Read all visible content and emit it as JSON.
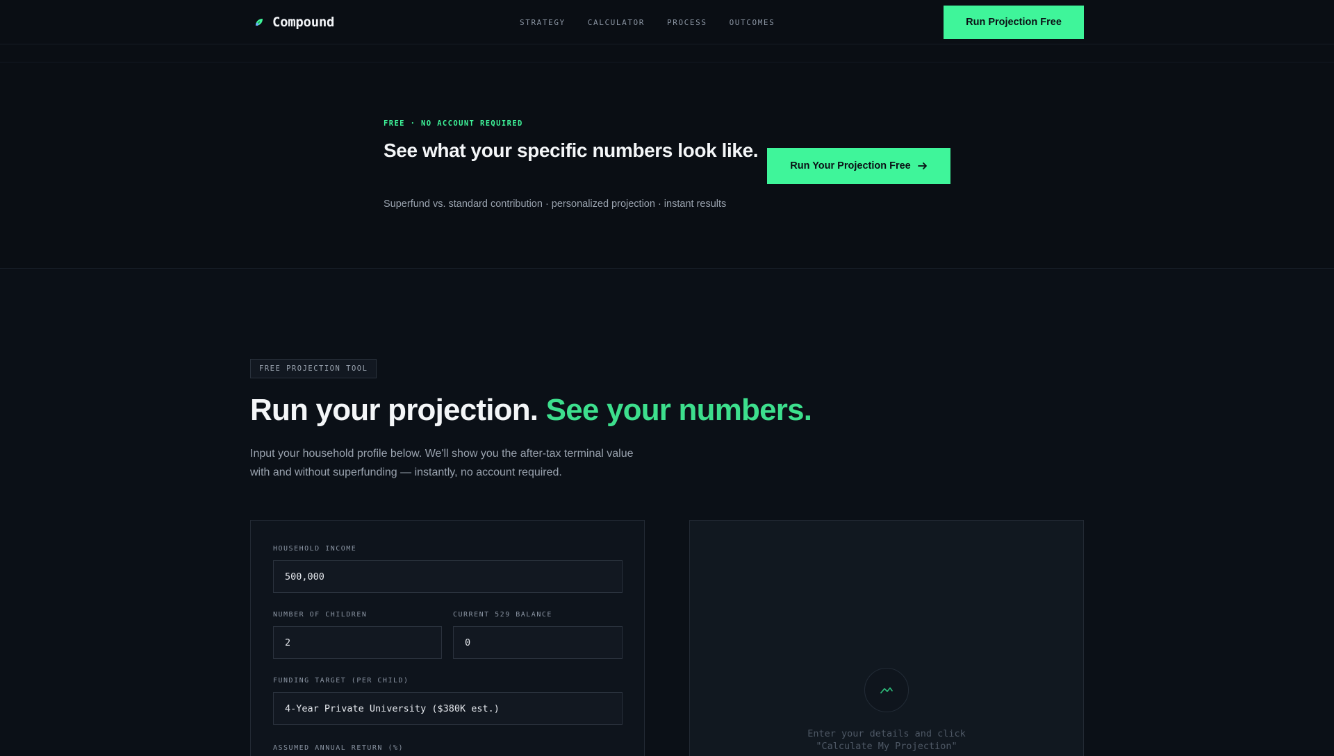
{
  "nav": {
    "brand": "Compound",
    "links": [
      "STRATEGY",
      "CALCULATOR",
      "PROCESS",
      "OUTCOMES"
    ],
    "cta": "Run Projection Free"
  },
  "banner": {
    "eyebrow": "FREE · NO ACCOUNT REQUIRED",
    "title": "See what your specific numbers look like.",
    "subtitle": "Superfund vs. standard contribution · personalized projection · instant results",
    "cta": "Run Your Projection Free"
  },
  "main": {
    "tag": "FREE PROJECTION TOOL",
    "title_part1": "Run your projection.",
    "title_part2": "See your numbers.",
    "description": "Input your household profile below. We'll show you the after-tax terminal value with and without superfunding — instantly, no account required."
  },
  "form": {
    "income_label": "HOUSEHOLD INCOME",
    "income_value": "500,000",
    "children_label": "NUMBER OF CHILDREN",
    "children_value": "2",
    "balance_label": "CURRENT 529 BALANCE",
    "balance_value": "0",
    "target_label": "FUNDING TARGET (PER CHILD)",
    "target_value": "4-Year Private University ($380K est.)",
    "return_label": "ASSUMED ANNUAL RETURN (%)"
  },
  "result": {
    "hint_line1": "Enter your details and click",
    "hint_line2": "\"Calculate My Projection\""
  },
  "colors": {
    "accent": "#3ff59a",
    "background": "#0a0e14"
  },
  "icons": {
    "brand": "leaf-icon",
    "cta_arrow": "arrow-right-icon",
    "result": "chart-line-icon"
  }
}
